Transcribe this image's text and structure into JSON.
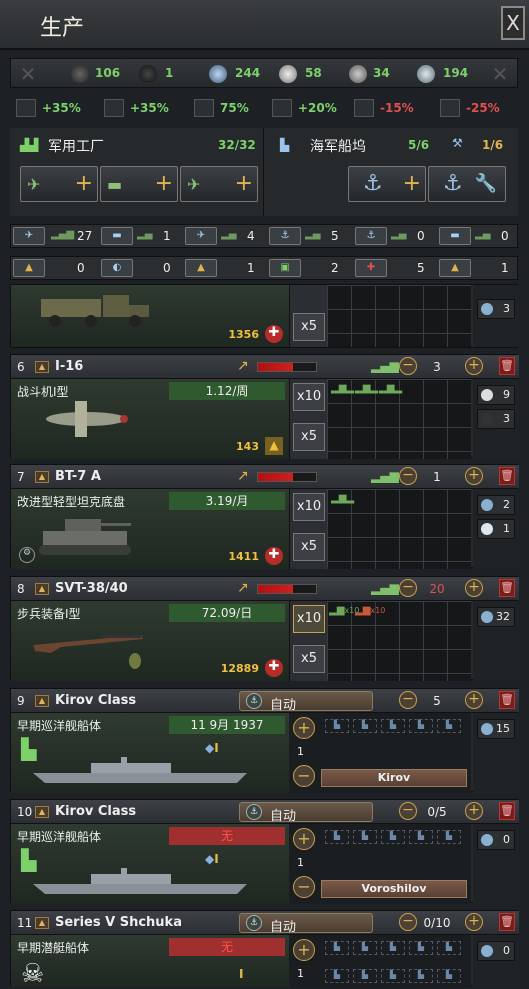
{
  "window": {
    "title": "生产",
    "close": "X"
  },
  "resources": [
    {
      "icon": "oil-icon",
      "value": "106"
    },
    {
      "icon": "rubber-icon",
      "value": "1"
    },
    {
      "icon": "steel-icon",
      "value": "244"
    },
    {
      "icon": "aluminium-icon",
      "value": "58"
    },
    {
      "icon": "tungsten-icon",
      "value": "34"
    },
    {
      "icon": "chromium-icon",
      "value": "194"
    }
  ],
  "modifiers": [
    {
      "icon": "factory-output-icon",
      "value": "+35%",
      "color": "#7ed06a"
    },
    {
      "icon": "production-efficiency-icon",
      "value": "+35%",
      "color": "#7ed06a"
    },
    {
      "icon": "efficiency-cap-icon",
      "value": "75%",
      "color": "#7ed06a"
    },
    {
      "icon": "efficiency-growth-icon",
      "value": "+20%",
      "color": "#7ed06a"
    },
    {
      "icon": "efficiency-retention-icon",
      "value": "-15%",
      "color": "#e05050"
    },
    {
      "icon": "resource-penalty-icon",
      "value": "-25%",
      "color": "#e05050"
    }
  ],
  "factories": {
    "military_label": "军用工厂",
    "military_count": "32/32",
    "naval_label": "海军船坞",
    "naval_count": "5/6",
    "naval_repair": "1/6"
  },
  "summary_row1": [
    {
      "value": "27"
    },
    {
      "value": "1"
    },
    {
      "value": "4"
    },
    {
      "value": "5"
    },
    {
      "value": "0"
    },
    {
      "value": "0"
    }
  ],
  "summary_row2": [
    {
      "value": "0"
    },
    {
      "value": "0"
    },
    {
      "value": "1"
    },
    {
      "value": "2"
    },
    {
      "value": "5"
    },
    {
      "value": "1"
    }
  ],
  "line0": {
    "cost": "1356",
    "need": "3"
  },
  "line6": {
    "num": "6",
    "name": "I-16",
    "count": "3",
    "item": "战斗机I型",
    "rate": "1.12/周",
    "cost": "143",
    "x10": "x10",
    "x5": "x5",
    "needs": [
      "9",
      "3"
    ],
    "efficiency": 0.6
  },
  "line7": {
    "num": "7",
    "name": "BT-7 A",
    "count": "1",
    "item": "改进型轻型坦克底盘",
    "rate": "3.19/月",
    "cost": "1411",
    "x10": "x10",
    "x5": "x5",
    "needs": [
      "2",
      "1"
    ],
    "efficiency": 0.6
  },
  "line8": {
    "num": "8",
    "name": "SVT-38/40",
    "count": "20",
    "item": "步兵装备I型",
    "rate": "72.09/日",
    "cost": "12889",
    "x10": "x10",
    "x5": "x5",
    "needs": [
      "32"
    ],
    "efficiency": 0.6
  },
  "line9": {
    "num": "9",
    "name": "Kirov Class",
    "auto": "自动",
    "count": "5",
    "item": "早期巡洋舰船体",
    "rate": "11 9月 1937",
    "qty": "1",
    "ship": "Kirov",
    "needs": [
      "15"
    ],
    "rank": "I"
  },
  "line10": {
    "num": "10",
    "name": "Kirov Class",
    "auto": "自动",
    "count": "0/5",
    "item": "早期巡洋舰船体",
    "rate": "无",
    "qty": "1",
    "ship": "Voroshilov",
    "needs": [
      "0"
    ],
    "rank": "I"
  },
  "line11": {
    "num": "11",
    "name": "Series V Shchuka",
    "auto": "自动",
    "count": "0/10",
    "item": "早期潜艇船体",
    "rate": "无",
    "qty": "1",
    "needs": [
      "0"
    ],
    "rank": "I"
  },
  "glyphs": {
    "x10": "x10"
  }
}
